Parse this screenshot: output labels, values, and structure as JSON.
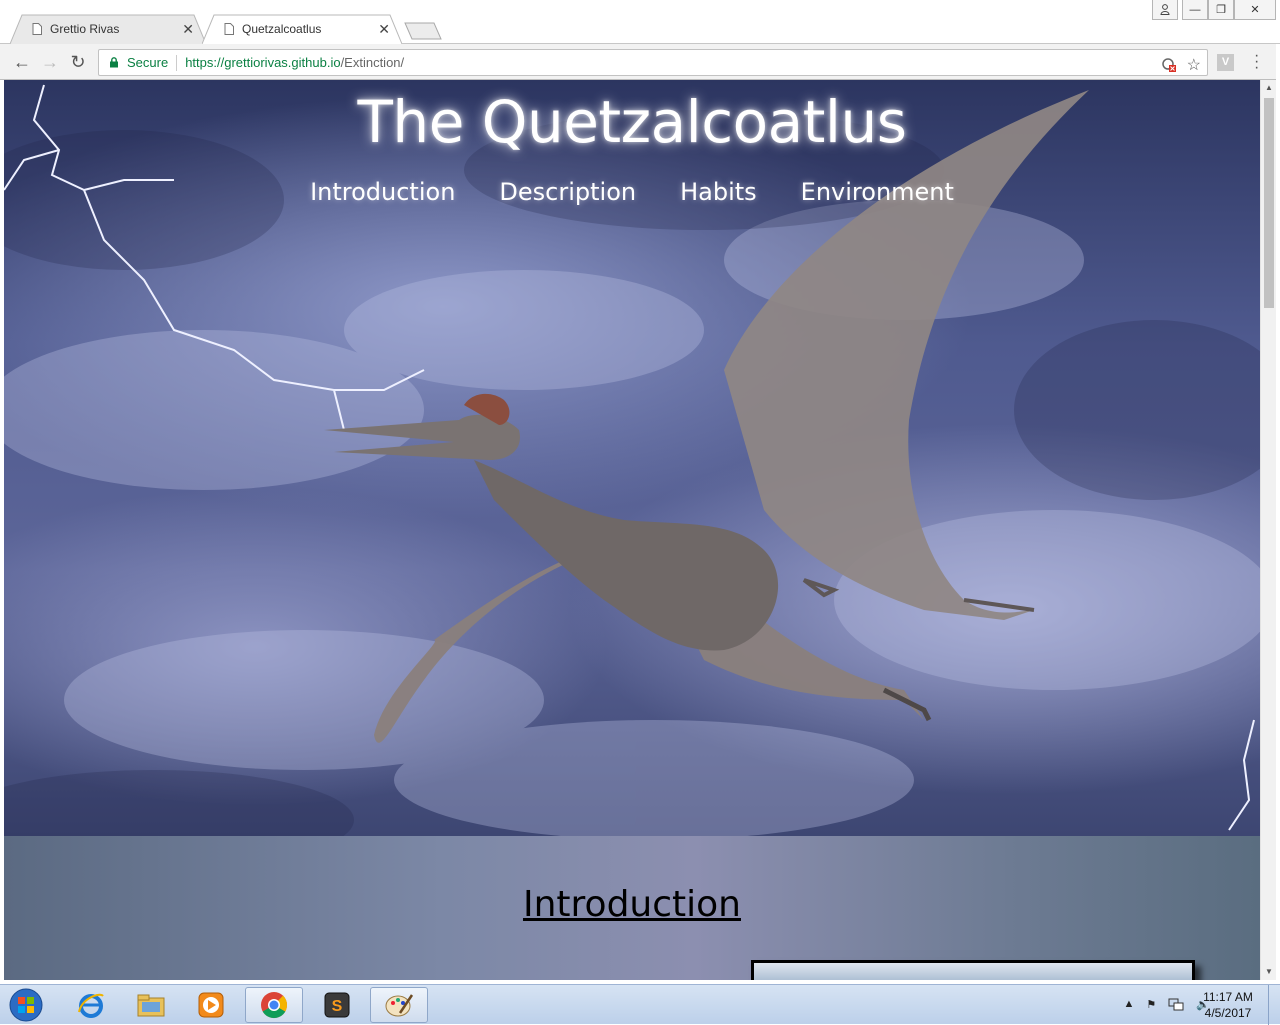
{
  "browser": {
    "tabs": [
      {
        "title": "Grettio Rivas",
        "active": false
      },
      {
        "title": "Quetzalcoatlus",
        "active": true
      }
    ],
    "security_label": "Secure",
    "url_host": "https://grettiorivas.github.io",
    "url_path": "/Extinction/",
    "extension_label": "V"
  },
  "page": {
    "site_title": "The Quetzalcoatlus",
    "nav": [
      "Introduction",
      "Description",
      "Habits",
      "Environment"
    ],
    "section_heading": "Introduction"
  },
  "taskbar": {
    "time": "11:17 AM",
    "date": "4/5/2017"
  },
  "colors": {
    "secure_green": "#0b8043",
    "sky_dark": "#2c3560",
    "sky_light": "#8d97c7",
    "intro_band": "#7c88a6"
  }
}
